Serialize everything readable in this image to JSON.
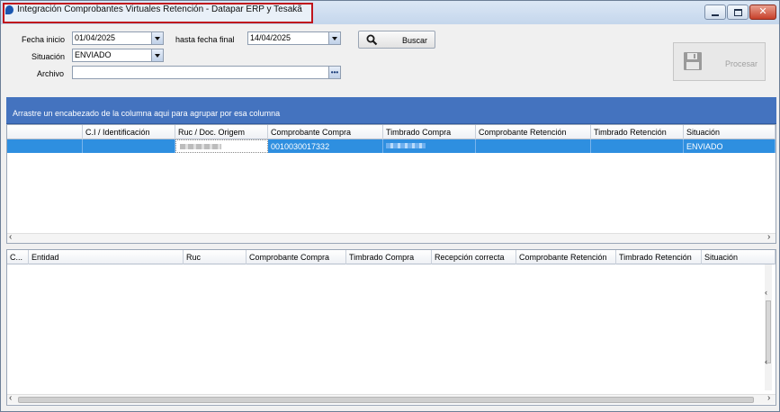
{
  "window": {
    "title": "Integración Comprobantes Virtuales Retención - Datapar ERP y Tesakã",
    "controls": [
      "minimize",
      "maximize",
      "close"
    ]
  },
  "filters": {
    "fecha_inicio_label": "Fecha inicio",
    "fecha_inicio_value": "01/04/2025",
    "hasta_label": "hasta fecha final",
    "hasta_value": "14/04/2025",
    "situacion_label": "Situación",
    "situacion_value": "ENVIADO",
    "archivo_label": "Archivo",
    "archivo_value": "",
    "buscar_label": "Buscar",
    "procesar_label": "Procesar"
  },
  "grid1": {
    "group_text": "Arrastre un encabezado de la columna aqui para agrupar por esa columna",
    "columns": [
      "",
      "C.I / Identificación",
      "Ruc / Doc. Origem",
      "Comprobante Compra",
      "Timbrado Compra",
      "Comprobante Retención",
      "Timbrado Retención",
      "Situación"
    ],
    "rows": [
      {
        "ci": "",
        "ruc": "",
        "comprobante_compra": "0010030017332",
        "timbrado_compra": "",
        "comprobante_retencion": "",
        "timbrado_retencion": "",
        "situacion": "ENVIADO"
      }
    ]
  },
  "grid2": {
    "columns": [
      "C...",
      "Entidad",
      "Ruc",
      "Comprobante Compra",
      "Timbrado Compra",
      "Recepción correcta",
      "Comprobante Retención",
      "Timbrado Retención",
      "Situación"
    ],
    "rows": []
  },
  "icons": {
    "app": "app-logo-icon",
    "search": "magnifier-icon",
    "save": "floppy-disk-icon",
    "ellipsis": "ellipsis-icon"
  },
  "colors": {
    "group_panel": "#4473bf",
    "selected_row": "#2e8fe0",
    "title_highlight": "#c0141c"
  }
}
